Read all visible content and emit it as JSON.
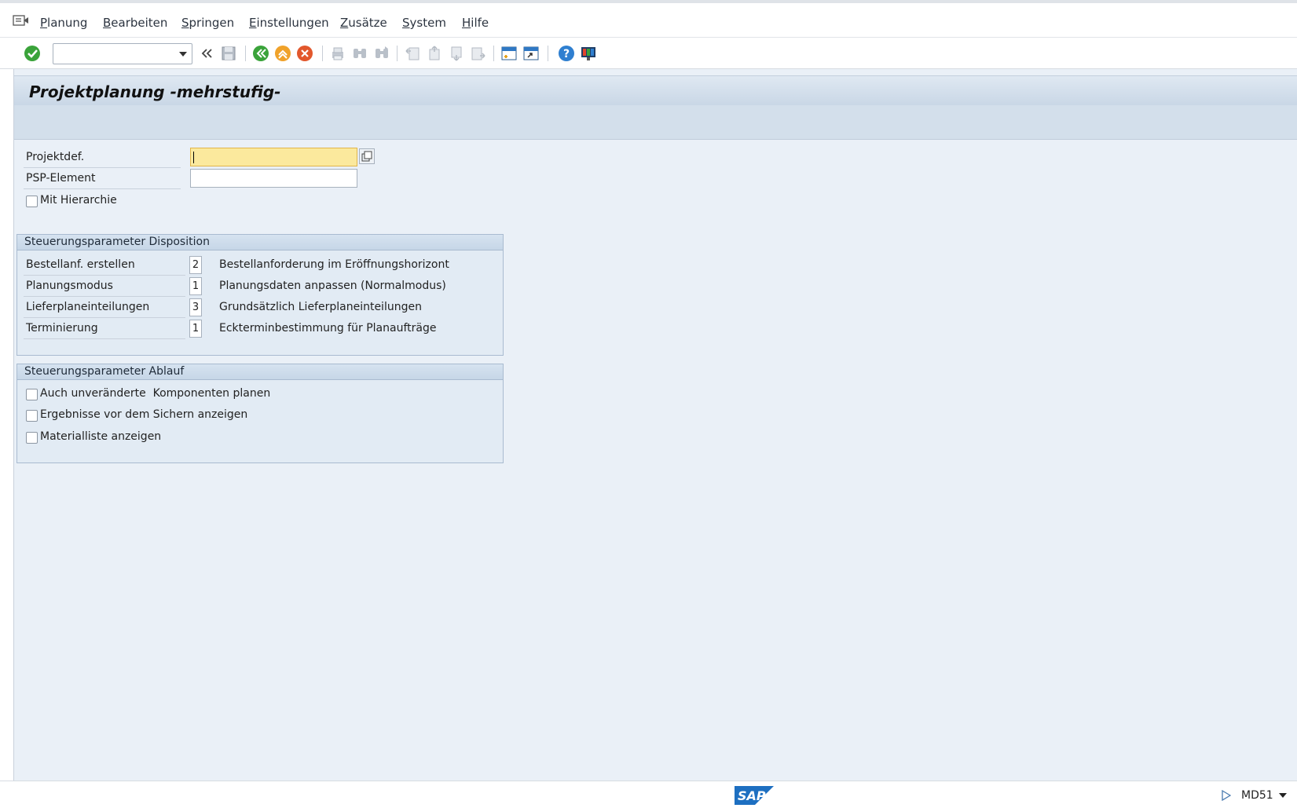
{
  "menubar": {
    "items": [
      {
        "label": "Planung"
      },
      {
        "label": "Bearbeiten"
      },
      {
        "label": "Springen"
      },
      {
        "label": "Einstellungen"
      },
      {
        "label": "Zusätze"
      },
      {
        "label": "System"
      },
      {
        "label": "Hilfe"
      }
    ]
  },
  "toolbar": {
    "command_field": {
      "value": "",
      "placeholder": ""
    },
    "icons": [
      "check-icon",
      "back-double-icon",
      "save-icon",
      "back-icon",
      "exit-icon",
      "cancel-icon",
      "print-icon",
      "find-icon",
      "find-next-icon",
      "first-page-icon",
      "prev-page-icon",
      "next-page-icon",
      "last-page-icon",
      "new-session-icon",
      "shortcut-icon",
      "help-icon",
      "customize-layout-icon"
    ]
  },
  "screen": {
    "title": "Projektplanung -mehrstufig-"
  },
  "fields": {
    "projektdef_label": "Projektdef.",
    "projektdef_value": "",
    "psp_label": "PSP-Element",
    "psp_value": "",
    "hierarchie_label": "Mit Hierarchie"
  },
  "group_disposition": {
    "title": "Steuerungsparameter Disposition",
    "rows": [
      {
        "label": "Bestellanf. erstellen",
        "value": "2",
        "desc": "Bestellanforderung im Eröffnungshorizont"
      },
      {
        "label": "Planungsmodus",
        "value": "1",
        "desc": "Planungsdaten anpassen (Normalmodus)"
      },
      {
        "label": "Lieferplaneinteilungen",
        "value": "3",
        "desc": "Grundsätzlich Lieferplaneinteilungen"
      },
      {
        "label": "Terminierung",
        "value": "1",
        "desc": "Eckterminbestimmung für Planaufträge"
      }
    ]
  },
  "group_ablauf": {
    "title": "Steuerungsparameter Ablauf",
    "options": [
      {
        "label": "Auch unveränderte  Komponenten planen",
        "checked": false
      },
      {
        "label": "Ergebnisse vor dem Sichern anzeigen",
        "checked": false
      },
      {
        "label": "Materialliste anzeigen",
        "checked": false
      }
    ]
  },
  "statusbar": {
    "logo_text": "SAP",
    "tcode": "MD51"
  },
  "colors": {
    "background": "#eaf0f7",
    "title_bar": "#c9d7e6",
    "active_input": "#fbe99d",
    "sap_blue": "#1d6fc1"
  }
}
